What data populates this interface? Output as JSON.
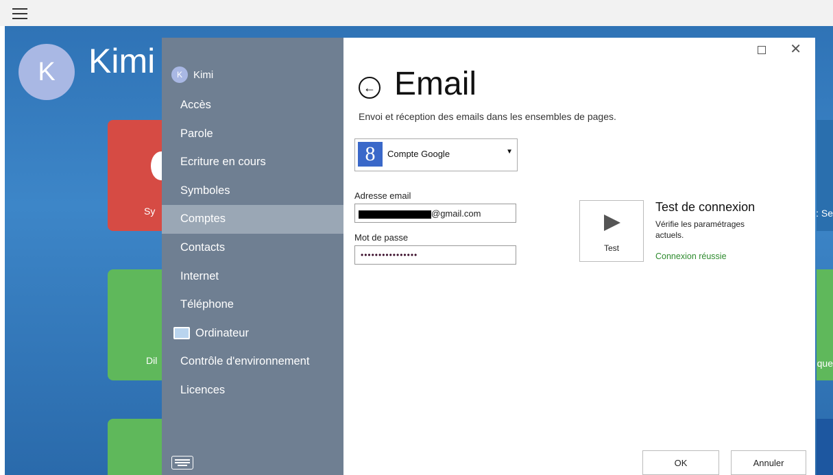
{
  "background": {
    "avatar_letter": "K",
    "user_name": "Kimi",
    "tiles": {
      "red_partial": "Sy",
      "green_partial": "Dil"
    },
    "right_partial": {
      "top": ": Se",
      "mid": "que"
    }
  },
  "sidebar": {
    "user_avatar_letter": "K",
    "user_name": "Kimi",
    "items": [
      {
        "label": "Accès"
      },
      {
        "label": "Parole"
      },
      {
        "label": "Ecriture en cours"
      },
      {
        "label": "Symboles"
      },
      {
        "label": "Comptes",
        "active": true
      },
      {
        "label": "Contacts"
      },
      {
        "label": "Internet"
      },
      {
        "label": "Téléphone"
      },
      {
        "label": "Ordinateur",
        "icon": "computer-icon"
      },
      {
        "label": "Contrôle d'environnement"
      },
      {
        "label": "Licences"
      }
    ]
  },
  "dialog": {
    "title": "Email",
    "description": "Envoi et réception des emails dans les ensembles de pages.",
    "account_select": {
      "value": "Compte Google",
      "icon": "google-icon",
      "logo_letter": "8"
    },
    "email": {
      "label": "Adresse email",
      "value_suffix": "@gmail.com"
    },
    "password": {
      "label": "Mot de passe",
      "value": "••••••••••••••••"
    },
    "test": {
      "button_label": "Test",
      "title": "Test de connexion",
      "description": "Vérifie les paramétrages actuels.",
      "status": "Connexion réussie",
      "status_color": "#2e8b2e"
    },
    "ok_label": "OK",
    "cancel_label": "Annuler"
  }
}
